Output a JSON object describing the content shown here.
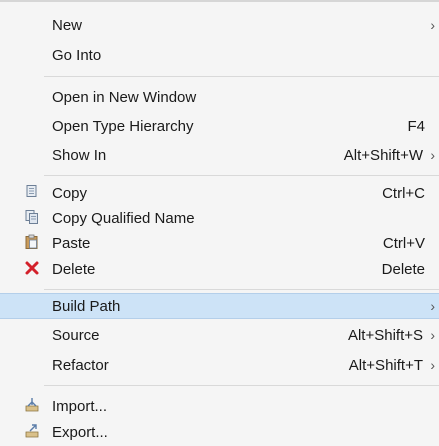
{
  "menu": {
    "items": [
      {
        "label": "New",
        "shortcut": "",
        "submenu": true
      },
      {
        "label": "Go Into",
        "shortcut": "",
        "submenu": false
      },
      {
        "label": "Open in New Window",
        "shortcut": "",
        "submenu": false
      },
      {
        "label": "Open Type Hierarchy",
        "shortcut": "F4",
        "submenu": false
      },
      {
        "label": "Show In",
        "shortcut": "Alt+Shift+W",
        "submenu": true
      },
      {
        "label": "Copy",
        "shortcut": "Ctrl+C",
        "icon": "copy-icon"
      },
      {
        "label": "Copy Qualified Name",
        "shortcut": "",
        "icon": "copy-qualified-name-icon"
      },
      {
        "label": "Paste",
        "shortcut": "Ctrl+V",
        "icon": "paste-icon"
      },
      {
        "label": "Delete",
        "shortcut": "Delete",
        "icon": "delete-icon"
      },
      {
        "label": "Build Path",
        "shortcut": "",
        "submenu": true,
        "highlighted": true
      },
      {
        "label": "Source",
        "shortcut": "Alt+Shift+S",
        "submenu": true
      },
      {
        "label": "Refactor",
        "shortcut": "Alt+Shift+T",
        "submenu": true
      },
      {
        "label": "Import...",
        "shortcut": "",
        "icon": "import-icon"
      },
      {
        "label": "Export...",
        "shortcut": "",
        "icon": "export-icon"
      }
    ],
    "arrow_glyph": "›",
    "colors": {
      "highlight": "#cde3f7",
      "background": "#f5f5f5",
      "delete_icon": "#d3202a"
    }
  }
}
